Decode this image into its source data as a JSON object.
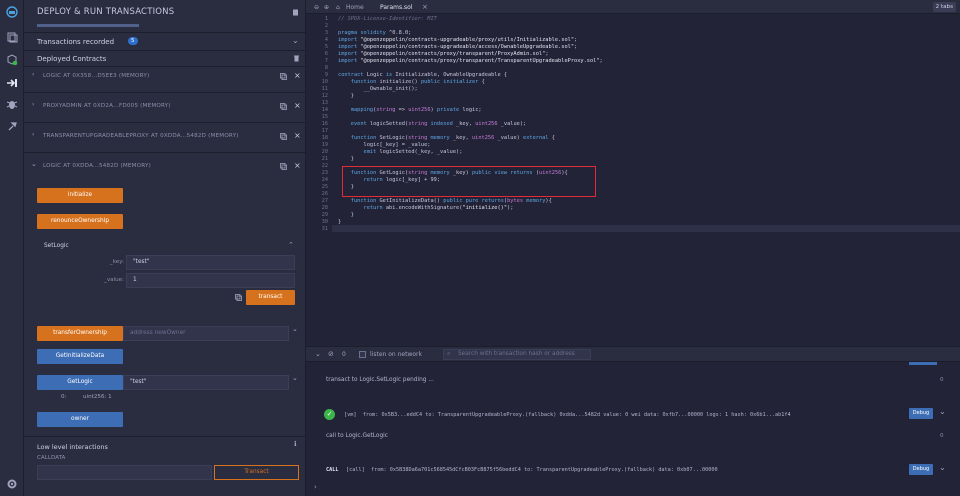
{
  "panel": {
    "title": "DEPLOY & RUN TRANSACTIONS",
    "transactions_recorded": "Transactions recorded",
    "transactions_count": "5",
    "deployed_contracts": "Deployed Contracts",
    "instances": [
      "LOGIC AT 0X358...D5EE3 (MEMORY)",
      "PROXYADMIN AT 0XD2A...FD005 (MEMORY)",
      "TRANSPARENTUPGRADEABLEPROXY AT 0XDDA...5482D (MEMORY)",
      "LOGIC AT 0XDDA...5482D (MEMORY)"
    ],
    "functions": {
      "initialize": "initialize",
      "renounce": "renounceOwnership",
      "setlogic_title": "SetLogic",
      "key_label": "_key:",
      "key_value": "\"test\"",
      "value_label": "_value:",
      "value_value": "1",
      "transact": "transact",
      "transfer": "transferOwnership",
      "transfer_placeholder": "address newOwner",
      "get_init": "GetInitializeData",
      "getlogic": "GetLogic",
      "getlogic_value": "\"test\"",
      "getlogic_result_index": "0:",
      "getlogic_result": "uint256: 1",
      "owner": "owner"
    },
    "low_level": "Low level interactions",
    "calldata": "CALLDATA",
    "low_transact": "Transact"
  },
  "editor": {
    "home_tab": "Home",
    "file_tab": "Params.sol",
    "tabs_count": "2 tabs",
    "lines": [
      {
        "n": "1",
        "t": "// SPDX-License-Identifier: MIT"
      },
      {
        "n": "2",
        "t": ""
      },
      {
        "n": "3",
        "t": "pragma solidity ^0.8.0;"
      },
      {
        "n": "4",
        "t": "import \"@openzeppelin/contracts-upgradeable/proxy/utils/Initializable.sol\";"
      },
      {
        "n": "5",
        "t": "import \"@openzeppelin/contracts-upgradeable/access/OwnableUpgradeable.sol\";"
      },
      {
        "n": "6",
        "t": "import \"@openzeppelin/contracts/proxy/transparent/ProxyAdmin.sol\";"
      },
      {
        "n": "7",
        "t": "import \"@openzeppelin/contracts/proxy/transparent/TransparentUpgradeableProxy.sol\";"
      },
      {
        "n": "8",
        "t": ""
      },
      {
        "n": "9",
        "t": "contract Logic is Initializable, OwnableUpgradeable {"
      },
      {
        "n": "10",
        "t": "    function initialize() public initializer {"
      },
      {
        "n": "11",
        "t": "        __Ownable_init();"
      },
      {
        "n": "12",
        "t": "    }"
      },
      {
        "n": "13",
        "t": ""
      },
      {
        "n": "14",
        "t": "    mapping(string => uint256) private logic;"
      },
      {
        "n": "15",
        "t": ""
      },
      {
        "n": "16",
        "t": "    event logicSetted(string indexed _key, uint256 _value);"
      },
      {
        "n": "17",
        "t": ""
      },
      {
        "n": "18",
        "t": "    function SetLogic(string memory _key, uint256 _value) external {"
      },
      {
        "n": "19",
        "t": "        logic[_key] = _value;"
      },
      {
        "n": "20",
        "t": "        emit logicSetted(_key, _value);"
      },
      {
        "n": "21",
        "t": "    }"
      },
      {
        "n": "22",
        "t": ""
      },
      {
        "n": "23",
        "t": "    function GetLogic(string memory _key) public view returns (uint256){"
      },
      {
        "n": "24",
        "t": "        return logic[_key] + 99;"
      },
      {
        "n": "25",
        "t": "    }"
      },
      {
        "n": "26",
        "t": ""
      },
      {
        "n": "27",
        "t": "    function GetInitializeData() public pure returns(bytes memory){"
      },
      {
        "n": "28",
        "t": "        return abi.encodeWithSignature(\"initialize()\");"
      },
      {
        "n": "29",
        "t": "    }"
      },
      {
        "n": "30",
        "t": "}"
      },
      {
        "n": "31",
        "t": ""
      }
    ]
  },
  "terminal": {
    "count": "0",
    "listen_label": "listen on network",
    "search_placeholder": "Search with transaction hash or address",
    "pending": "transact to Logic.SetLogic pending ...",
    "vm_line": "[vm]  from: 0x5B3...eddC4 to: TransparentUpgradeableProxy.(fallback) 0xdda...5482d value: 0 wei data: 0xfb7...00000 logs: 1 hash: 0x6b1...ab1f4",
    "call_to": "call to Logic.GetLogic",
    "call_label": "CALL",
    "call_line": "[call]  from: 0x5B38Da6a701c568545dCfcB03FcB875f56beddC4 to: TransparentUpgradeableProxy.(fallback) data: 0xb07...00000",
    "debug": "Debug",
    "zero": "0"
  },
  "colors": {
    "accent_orange": "#d6721d",
    "accent_blue": "#3d6db5",
    "highlight_red": "#e12b36",
    "success_green": "#3bb54a"
  }
}
